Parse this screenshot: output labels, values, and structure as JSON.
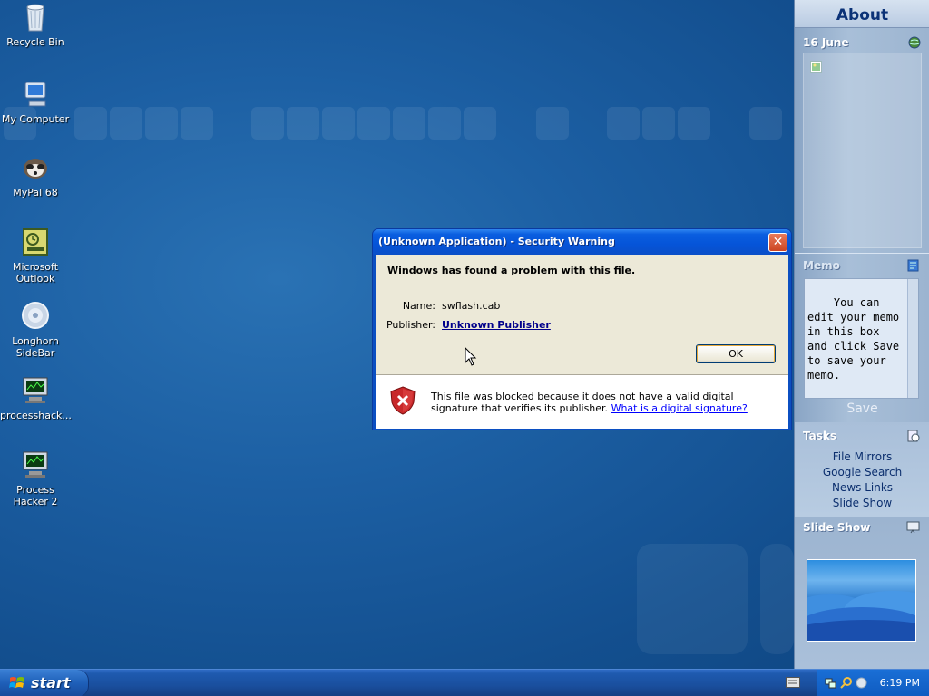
{
  "desktop": {
    "icons": [
      {
        "label": "Recycle Bin",
        "icon": "recycle-bin-icon"
      },
      {
        "label": "My Computer",
        "icon": "my-computer-icon"
      },
      {
        "label": "MyPal 68",
        "icon": "mypal-icon"
      },
      {
        "label": "Microsoft Outlook",
        "icon": "outlook-icon"
      },
      {
        "label": "Longhorn SideBar",
        "icon": "longhorn-sidebar-icon"
      },
      {
        "label": "processhack...",
        "icon": "process-hacker-icon"
      },
      {
        "label": "Process Hacker 2",
        "icon": "process-hacker-2-icon"
      }
    ]
  },
  "dialog": {
    "title": "(Unknown Application) - Security Warning",
    "close_label": "✕",
    "headline": "Windows has found a problem with this file.",
    "name_label": "Name:",
    "name_value": "swflash.cab",
    "publisher_label": "Publisher:",
    "publisher_value": "Unknown Publisher",
    "ok_label": "OK",
    "warning_text": "This file was blocked because it does not have a valid digital signature that verifies its publisher.",
    "warning_link": "What is a digital signature?",
    "colors": {
      "titlebar": "#0554d8",
      "link": "#0000ff",
      "shield": "#c8282a"
    }
  },
  "sidebar": {
    "about": "About",
    "calendar": {
      "date": "16 June"
    },
    "memo": {
      "title": "Memo",
      "text": "You can edit your memo in this box and click Save to save your memo.",
      "save_label": "Save"
    },
    "tasks": {
      "title": "Tasks",
      "items": [
        "File Mirrors",
        "Google Search",
        "News Links",
        "Slide Show"
      ]
    },
    "slideshow": {
      "title": "Slide Show"
    }
  },
  "taskbar": {
    "start_label": "start",
    "clock": "6:19 PM"
  }
}
